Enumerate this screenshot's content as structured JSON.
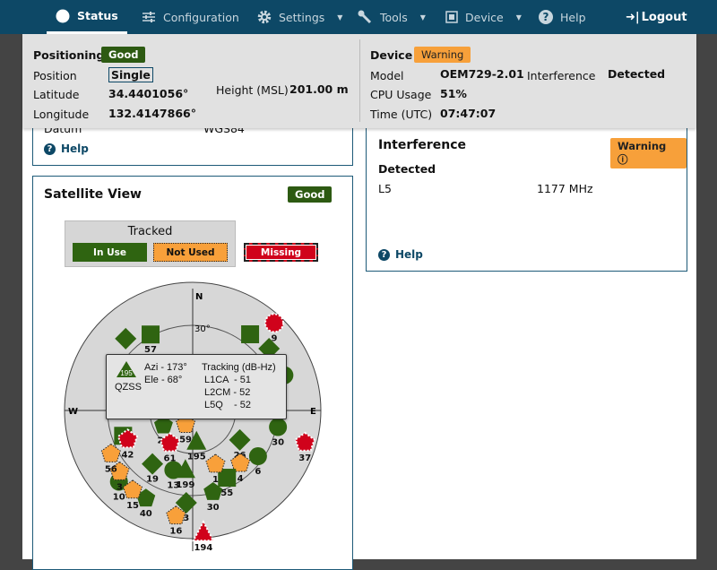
{
  "nav": {
    "items": [
      {
        "label": "Status",
        "icon": "compass-icon",
        "active": true
      },
      {
        "label": "Configuration",
        "icon": "sliders-icon"
      },
      {
        "label": "Settings",
        "icon": "gear-icon",
        "dropdown": true
      },
      {
        "label": "Tools",
        "icon": "wrench-icon",
        "dropdown": true
      },
      {
        "label": "Device",
        "icon": "chip-icon",
        "dropdown": true
      },
      {
        "label": "Help",
        "icon": "help-circle-icon"
      }
    ],
    "logout": "Logout"
  },
  "status_panel": {
    "positioning": {
      "title": "Positioning",
      "badge": "Good",
      "position_label": "Position",
      "position_value": "Single",
      "latitude_label": "Latitude",
      "latitude_value": "34.4401056°",
      "longitude_label": "Longitude",
      "longitude_value": "132.4147866°",
      "height_label": "Height (MSL)",
      "height_value": "201.00 m"
    },
    "device": {
      "title": "Device",
      "badge": "Warning",
      "model_label": "Model",
      "model_value": "OEM729-2.01",
      "interference_label": "Interference",
      "interference_value": "Detected",
      "cpu_label": "CPU Usage",
      "cpu_value": "51%",
      "time_label": "Time (UTC)",
      "time_value": "07:47:07"
    }
  },
  "position_card": {
    "datum_label": "Datum",
    "datum_value": "WGS84",
    "help": "Help"
  },
  "satellite_card": {
    "title": "Satellite View",
    "badge": "Good",
    "legend": {
      "title": "Tracked",
      "in_use": "In Use",
      "not_used": "Not Used",
      "missing": "Missing"
    },
    "compass": {
      "n": "N",
      "e": "E",
      "w": "W",
      "ring_label": "30°"
    },
    "colors": {
      "in_use": "#2f6411",
      "not_used": "#f8a03a",
      "missing": "#d0021b"
    },
    "satellites": [
      {
        "prn": "9",
        "shape": "circle",
        "status": "missing",
        "az": 43,
        "el": 6
      },
      {
        "prn": "57",
        "shape": "square",
        "status": "in_use",
        "az": 331,
        "el": 29
      },
      {
        "prn": "",
        "shape": "square",
        "status": "in_use",
        "az": 37,
        "el": 23
      },
      {
        "prn": "",
        "shape": "diamond",
        "status": "in_use",
        "az": 317,
        "el": 21
      },
      {
        "prn": "",
        "shape": "diamond",
        "status": "in_use",
        "az": 51,
        "el": 21
      },
      {
        "prn": "",
        "shape": "circle",
        "status": "in_use",
        "az": 69,
        "el": 21
      },
      {
        "prn": "30",
        "shape": "circle",
        "status": "in_use",
        "az": 101,
        "el": 29
      },
      {
        "prn": "37",
        "shape": "pentagon",
        "status": "missing",
        "az": 106,
        "el": 8
      },
      {
        "prn": "26",
        "shape": "diamond",
        "status": "in_use",
        "az": 122,
        "el": 51
      },
      {
        "prn": "6",
        "shape": "circle",
        "status": "in_use",
        "az": 125,
        "el": 34
      },
      {
        "prn": "4",
        "shape": "pentagon",
        "status": "not_used",
        "az": 138,
        "el": 40
      },
      {
        "prn": "55",
        "shape": "square",
        "status": "in_use",
        "az": 153,
        "el": 37
      },
      {
        "prn": "1",
        "shape": "pentagon",
        "status": "not_used",
        "az": 157,
        "el": 49
      },
      {
        "prn": "30",
        "shape": "pentagon",
        "status": "in_use",
        "az": 166,
        "el": 31
      },
      {
        "prn": "195",
        "shape": "triangle",
        "status": "in_use",
        "az": 173,
        "el": 68
      },
      {
        "prn": "194",
        "shape": "triangle",
        "status": "missing",
        "az": 175,
        "el": 4
      },
      {
        "prn": "3",
        "shape": "diamond",
        "status": "in_use",
        "az": 184,
        "el": 25
      },
      {
        "prn": "16",
        "shape": "pentagon",
        "status": "not_used",
        "az": 189,
        "el": 15
      },
      {
        "prn": "40",
        "shape": "pentagon",
        "status": "in_use",
        "az": 208,
        "el": 20
      },
      {
        "prn": "10",
        "shape": "circle",
        "status": "in_use",
        "az": 226,
        "el": 18
      },
      {
        "prn": "15",
        "shape": "pentagon",
        "status": "not_used",
        "az": 217,
        "el": 20
      },
      {
        "prn": "3",
        "shape": "pentagon",
        "status": "not_used",
        "az": 230,
        "el": 23
      },
      {
        "prn": "56",
        "shape": "pentagon",
        "status": "not_used",
        "az": 242,
        "el": 25
      },
      {
        "prn": "",
        "shape": "square",
        "status": "in_use",
        "az": 250,
        "el": 38
      },
      {
        "prn": "42",
        "shape": "pentagon",
        "status": "missing",
        "az": 246,
        "el": 40
      },
      {
        "prn": "19",
        "shape": "diamond",
        "status": "in_use",
        "az": 217,
        "el": 43
      },
      {
        "prn": "13",
        "shape": "circle",
        "status": "in_use",
        "az": 198,
        "el": 46
      },
      {
        "prn": "199",
        "shape": "triangle",
        "status": "in_use",
        "az": 187,
        "el": 48
      },
      {
        "prn": "21",
        "shape": "pentagon",
        "status": "in_use",
        "az": 243,
        "el": 67
      },
      {
        "prn": "61",
        "shape": "pentagon",
        "status": "missing",
        "az": 215,
        "el": 62
      },
      {
        "prn": "59",
        "shape": "pentagon",
        "status": "not_used",
        "az": 207,
        "el": 79
      }
    ],
    "tooltip": {
      "prn": "195",
      "system": "QZSS",
      "azi": "Azi - 173°",
      "ele": "Ele - 68°",
      "tracking_title": "Tracking (dB-Hz)",
      "signals": [
        "L1CA  - 51",
        "L2CM - 52",
        "L5Q    - 52"
      ]
    }
  },
  "interference_card": {
    "title": "Interference",
    "badge": "Warning",
    "detected": "Detected",
    "band": "L5",
    "frequency": "1177 MHz",
    "help": "Help"
  }
}
